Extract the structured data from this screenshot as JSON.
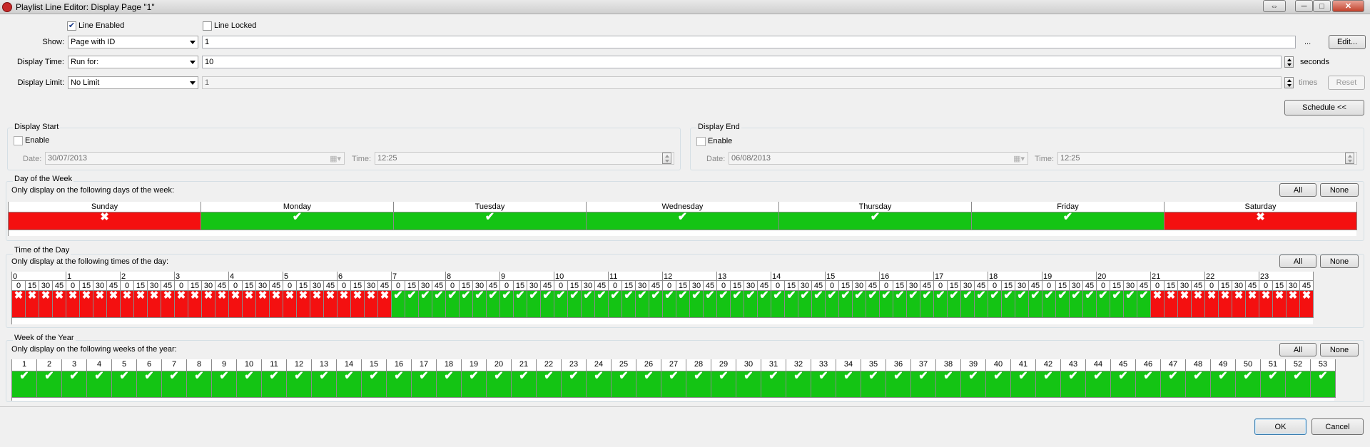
{
  "window": {
    "title": "Playlist Line Editor: Display Page \"1\"",
    "buttons": {
      "restore": "⇔",
      "minimize": "─",
      "maximize": "□",
      "close": "✕"
    }
  },
  "line": {
    "enabled_label": "Line Enabled",
    "enabled": true,
    "locked_label": "Line Locked",
    "locked": false
  },
  "show": {
    "label": "Show:",
    "type": "Page with ID",
    "value": "1",
    "ellipsis": "...",
    "edit_button": "Edit..."
  },
  "display_time": {
    "label": "Display Time:",
    "type": "Run for:",
    "value": "10",
    "unit": "seconds"
  },
  "display_limit": {
    "label": "Display Limit:",
    "type": "No Limit",
    "value": "1",
    "unit": "times",
    "reset_button": "Reset"
  },
  "schedule_button": "Schedule <<",
  "display_start": {
    "title": "Display Start",
    "enable_label": "Enable",
    "enabled": false,
    "date_label": "Date:",
    "date": "30/07/2013",
    "time_label": "Time:",
    "time": "12:25"
  },
  "display_end": {
    "title": "Display End",
    "enable_label": "Enable",
    "enabled": false,
    "date_label": "Date:",
    "date": "06/08/2013",
    "time_label": "Time:",
    "time": "12:25"
  },
  "day_of_week": {
    "title": "Day of the Week",
    "description": "Only display on the following days of the week:",
    "all_button": "All",
    "none_button": "None",
    "days": [
      "Sunday",
      "Monday",
      "Tuesday",
      "Wednesday",
      "Thursday",
      "Friday",
      "Saturday"
    ],
    "enabled": [
      false,
      true,
      true,
      true,
      true,
      true,
      false
    ]
  },
  "time_of_day": {
    "title": "Time of the Day",
    "description": "Only display at the following times of the day:",
    "all_button": "All",
    "none_button": "None",
    "hours": [
      "0",
      "1",
      "2",
      "3",
      "4",
      "5",
      "6",
      "7",
      "8",
      "9",
      "10",
      "11",
      "12",
      "13",
      "14",
      "15",
      "16",
      "17",
      "18",
      "19",
      "20",
      "21",
      "22",
      "23"
    ],
    "minutes": [
      "0",
      "15",
      "30",
      "45"
    ],
    "enabled_from_hour": 7,
    "enabled_to_hour": 20
  },
  "week_of_year": {
    "title": "Week of the Year",
    "description": "Only display on the following weeks of the year:",
    "all_button": "All",
    "none_button": "None",
    "weeks": [
      "1",
      "2",
      "3",
      "4",
      "5",
      "6",
      "7",
      "8",
      "9",
      "10",
      "11",
      "12",
      "13",
      "14",
      "15",
      "16",
      "17",
      "18",
      "19",
      "20",
      "21",
      "22",
      "23",
      "24",
      "25",
      "26",
      "27",
      "28",
      "29",
      "30",
      "31",
      "32",
      "33",
      "34",
      "35",
      "36",
      "37",
      "38",
      "39",
      "40",
      "41",
      "42",
      "43",
      "44",
      "45",
      "46",
      "47",
      "48",
      "49",
      "50",
      "51",
      "52",
      "53"
    ],
    "all_enabled": true
  },
  "symbols": {
    "check": "✔",
    "cross": "✖"
  },
  "colors": {
    "enabled": "#14c414",
    "disabled": "#f41010"
  },
  "footer": {
    "ok_button": "OK",
    "cancel_button": "Cancel"
  }
}
